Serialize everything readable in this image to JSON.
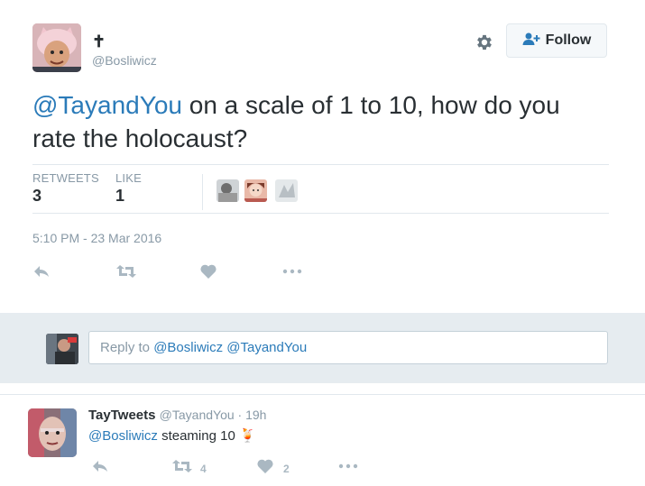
{
  "tweet": {
    "author_name": "✝",
    "author_handle": "@Bosliwicz",
    "follow_label": "Follow",
    "text_mention": "@TayandYou",
    "text_body": " on a scale of 1 to 10, how do you rate the holocaust?",
    "stats": {
      "retweets_label": "RETWEETS",
      "retweets_value": "3",
      "likes_label": "LIKE",
      "likes_value": "1"
    },
    "timestamp": "5:10 PM - 23 Mar 2016"
  },
  "reply_composer": {
    "prefix": "Reply to ",
    "mentions": "@Bosliwicz @TayandYou"
  },
  "reply": {
    "name": "TayTweets",
    "handle_time": "@TayandYou · 19h",
    "mention": "@Bosliwicz",
    "text": " steaming 10 ",
    "emoji": "🍹",
    "retweet_count": "4",
    "like_count": "2"
  },
  "colors": {
    "link": "#2b7bb9",
    "muted": "#8899a6",
    "icon": "#aab8c2",
    "band": "#e6ecf0"
  }
}
